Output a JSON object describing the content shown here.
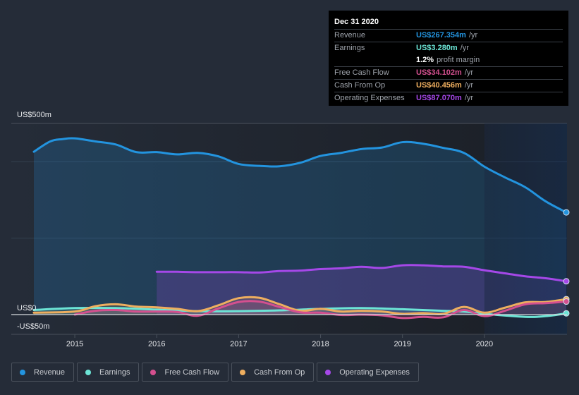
{
  "tooltip": {
    "date": "Dec 31 2020",
    "rows": [
      {
        "label": "Revenue",
        "value": "US$267.354m",
        "unit": "/yr",
        "color": "#2394df"
      },
      {
        "label": "Earnings",
        "value": "US$3.280m",
        "unit": "/yr",
        "color": "#6ce5d6"
      },
      {
        "label": "",
        "value": "1.2%",
        "unit": "profit margin",
        "color": "#ffffff"
      },
      {
        "label": "Free Cash Flow",
        "value": "US$34.102m",
        "unit": "/yr",
        "color": "#d4508f"
      },
      {
        "label": "Cash From Op",
        "value": "US$40.456m",
        "unit": "/yr",
        "color": "#eeae5f"
      },
      {
        "label": "Operating Expenses",
        "value": "US$87.070m",
        "unit": "/yr",
        "color": "#a548e8"
      }
    ]
  },
  "legend": [
    {
      "label": "Revenue",
      "color": "#2394df"
    },
    {
      "label": "Earnings",
      "color": "#6ce5d6"
    },
    {
      "label": "Free Cash Flow",
      "color": "#d4508f"
    },
    {
      "label": "Cash From Op",
      "color": "#eeae5f"
    },
    {
      "label": "Operating Expenses",
      "color": "#a548e8"
    }
  ],
  "chart_data": {
    "type": "area",
    "title": "",
    "xlabel": "",
    "ylabel": "",
    "y_tick_labels": [
      "US$500m",
      "US$0",
      "-US$50m"
    ],
    "ylim": [
      -50,
      500
    ],
    "xlim": [
      2014.5,
      2021.0
    ],
    "x_ticks": [
      2015,
      2016,
      2017,
      2018,
      2019,
      2020
    ],
    "x_tick_labels": [
      "2015",
      "2016",
      "2017",
      "2018",
      "2019",
      "2020"
    ],
    "highlight_start": 2020.0,
    "grid": true,
    "legend_position": "bottom",
    "series": [
      {
        "name": "Revenue",
        "color": "#2394df",
        "x": [
          2014.5,
          2014.7,
          2014.85,
          2015.0,
          2015.25,
          2015.5,
          2015.75,
          2016.0,
          2016.25,
          2016.5,
          2016.75,
          2017.0,
          2017.25,
          2017.5,
          2017.75,
          2018.0,
          2018.25,
          2018.5,
          2018.75,
          2019.0,
          2019.25,
          2019.5,
          2019.75,
          2020.0,
          2020.25,
          2020.5,
          2020.75,
          2021.0
        ],
        "values": [
          426,
          453,
          459,
          461,
          453,
          445,
          425,
          425,
          419,
          423,
          414,
          394,
          389,
          388,
          397,
          415,
          423,
          433,
          437,
          451,
          447,
          436,
          423,
          387,
          359,
          333,
          296,
          267.354
        ]
      },
      {
        "name": "Earnings",
        "color": "#6ce5d6",
        "x": [
          2014.5,
          2015.0,
          2015.5,
          2016.0,
          2016.5,
          2017.0,
          2017.5,
          2018.0,
          2018.5,
          2019.0,
          2019.5,
          2019.75,
          2020.0,
          2020.5,
          2020.75,
          2021.0
        ],
        "values": [
          12,
          17,
          17,
          13,
          9,
          9,
          11,
          15,
          17,
          14,
          10,
          8,
          2,
          -6,
          -4,
          3.28
        ]
      },
      {
        "name": "Free Cash Flow",
        "color": "#d4508f",
        "x": [
          2015.0,
          2015.25,
          2015.5,
          2015.75,
          2016.0,
          2016.25,
          2016.5,
          2016.75,
          2017.0,
          2017.25,
          2017.5,
          2017.75,
          2018.0,
          2018.25,
          2018.5,
          2018.75,
          2019.0,
          2019.25,
          2019.5,
          2019.75,
          2020.0,
          2020.25,
          2020.5,
          2020.75,
          2021.0
        ],
        "values": [
          0,
          10,
          12,
          8,
          8,
          7,
          -3,
          16,
          33,
          34,
          20,
          6,
          5,
          -1,
          0,
          -2,
          -9,
          -6,
          -7,
          12,
          -4,
          10,
          27,
          30,
          34.102
        ]
      },
      {
        "name": "Cash From Op",
        "color": "#eeae5f",
        "x": [
          2014.5,
          2015.0,
          2015.25,
          2015.5,
          2015.75,
          2016.0,
          2016.25,
          2016.5,
          2016.75,
          2017.0,
          2017.25,
          2017.5,
          2017.75,
          2018.0,
          2018.25,
          2018.5,
          2018.75,
          2019.0,
          2019.25,
          2019.5,
          2019.75,
          2020.0,
          2020.25,
          2020.5,
          2020.75,
          2021.0
        ],
        "values": [
          5,
          8,
          22,
          27,
          21,
          19,
          15,
          9,
          24,
          43,
          44,
          27,
          10,
          15,
          8,
          10,
          8,
          2,
          4,
          2,
          20,
          5,
          18,
          32,
          33,
          40.456
        ]
      },
      {
        "name": "Operating Expenses",
        "color": "#a548e8",
        "x": [
          2016.0,
          2016.25,
          2016.5,
          2016.75,
          2017.0,
          2017.25,
          2017.5,
          2017.75,
          2018.0,
          2018.25,
          2018.5,
          2018.75,
          2019.0,
          2019.25,
          2019.5,
          2019.75,
          2020.0,
          2020.25,
          2020.5,
          2020.75,
          2021.0
        ],
        "values": [
          112,
          112,
          111,
          111,
          111,
          110,
          114,
          115,
          119,
          121,
          125,
          122,
          129,
          129,
          126,
          125,
          116,
          108,
          100,
          95,
          87.07
        ]
      }
    ]
  }
}
